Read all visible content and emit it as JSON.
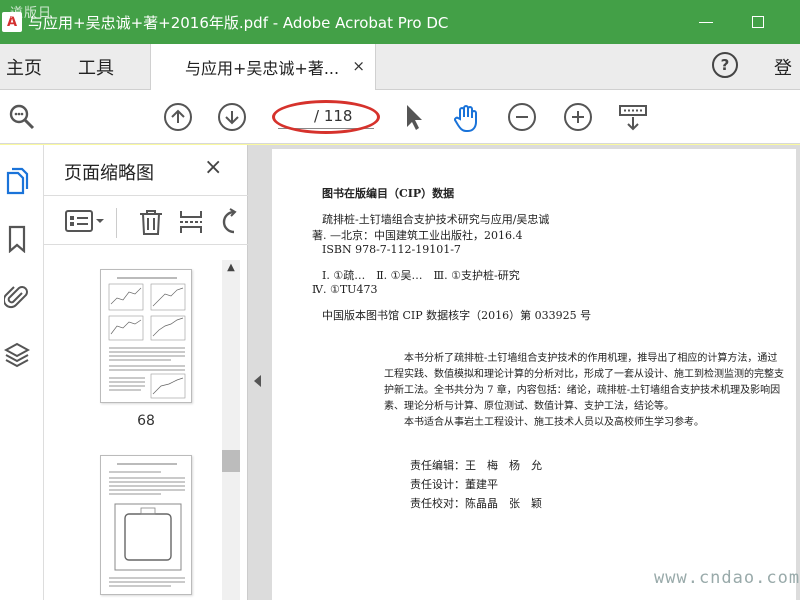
{
  "window": {
    "title": "与应用+吴忠诚+著+2016年版.pdf - Adobe Acrobat Pro DC",
    "corner_watermark": "道版日"
  },
  "menu": {
    "home": "主页",
    "tools": "工具",
    "login": "登"
  },
  "tab": {
    "label": "与应用+吴忠诚+著...",
    "close": "×"
  },
  "toolbar": {
    "page_input": "",
    "page_total": "/ 118"
  },
  "thumbnails_panel": {
    "title": "页面缩略图",
    "close": "×",
    "pages": [
      {
        "number": "68"
      },
      {
        "number": ""
      }
    ]
  },
  "document": {
    "cip_title": "图书在版编目（CIP）数据",
    "lines": [
      "疏排桩-土钉墙组合支护技术研究与应用/吴忠诚",
      "著. —北京：中国建筑工业出版社，2016.4",
      "ISBN 978-7-112-19101-7",
      "Ⅰ. ①疏…　Ⅱ. ①吴…　Ⅲ. ①支护桩-研究",
      "Ⅳ. ①TU473",
      "中国版本图书馆 CIP 数据核字（2016）第 033925 号"
    ],
    "paragraphs": [
      "本书分析了疏排桩-土钉墙组合支护技术的作用机理，推导出了相应的计算方法，通过工程实践、数值模拟和理论计算的分析对比，形成了一套从设计、施工到检测监测的完整支护新工法。全书共分为 7 章，内容包括：绪论，疏排桩-土钉墙组合支护技术机理及影响因素、理论分析与计算、原位测试、数值计算、支护工法，结论等。",
      "本书适合从事岩土工程设计、施工技术人员以及高校师生学习参考。"
    ],
    "credits": [
      "责任编辑：王　梅　杨　允",
      "责任设计：董建平",
      "责任校对：陈晶晶　张　颖"
    ]
  },
  "watermark": "www.cndao.com",
  "colors": {
    "titlebar": "#43a047",
    "highlight_ellipse": "#d6322c",
    "rail_active": "#1a73d9"
  }
}
